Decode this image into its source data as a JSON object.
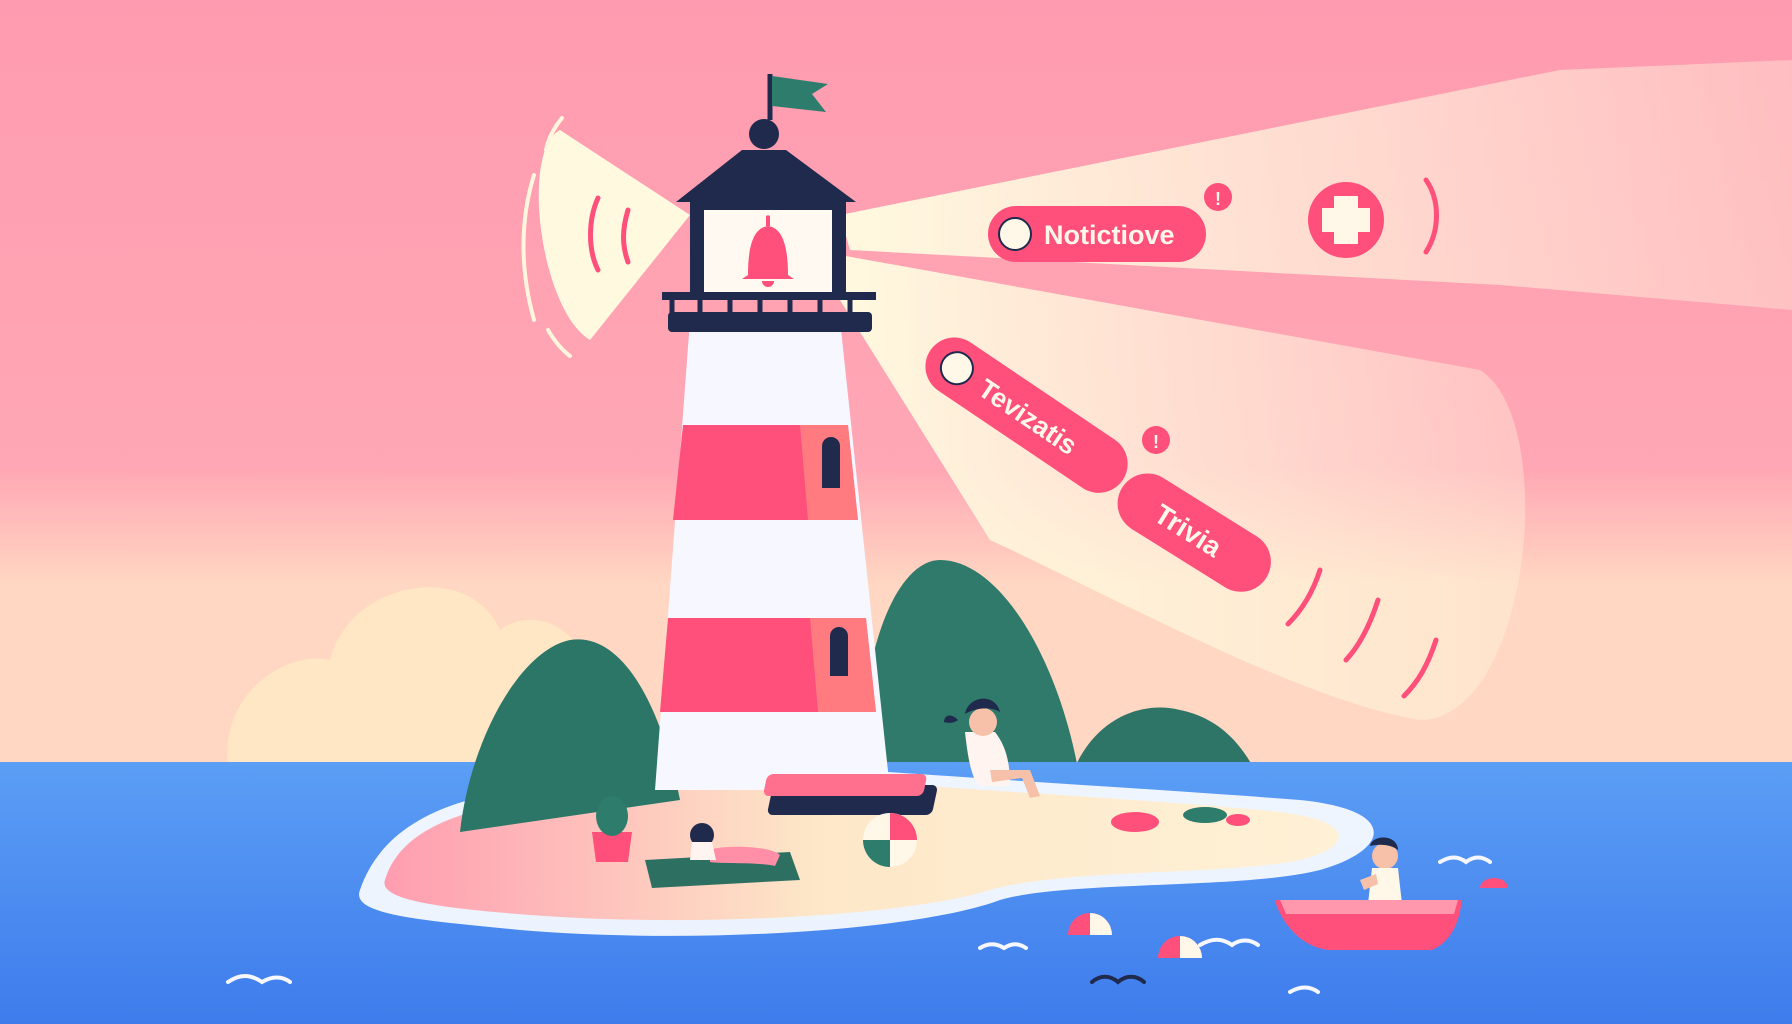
{
  "beam_labels": {
    "top_pill": "Notictiove",
    "middle_pill": "Tevizatis",
    "lower_pill": "Trivia"
  },
  "icons": {
    "lantern": "bell-icon",
    "top_action": "plus-icon",
    "badges": "exclamation-icon",
    "toggle_knob": "toggle-knob-icon",
    "flag": "flag-icon"
  },
  "colors": {
    "sky": "#ff9fb0",
    "beam": "#fdf6d8",
    "accent_pink": "#ff4f7b",
    "navy": "#1f2a4d",
    "island_green": "#2f7a6b",
    "sea": "#4a88f0",
    "sand": "#fbe8c9"
  }
}
